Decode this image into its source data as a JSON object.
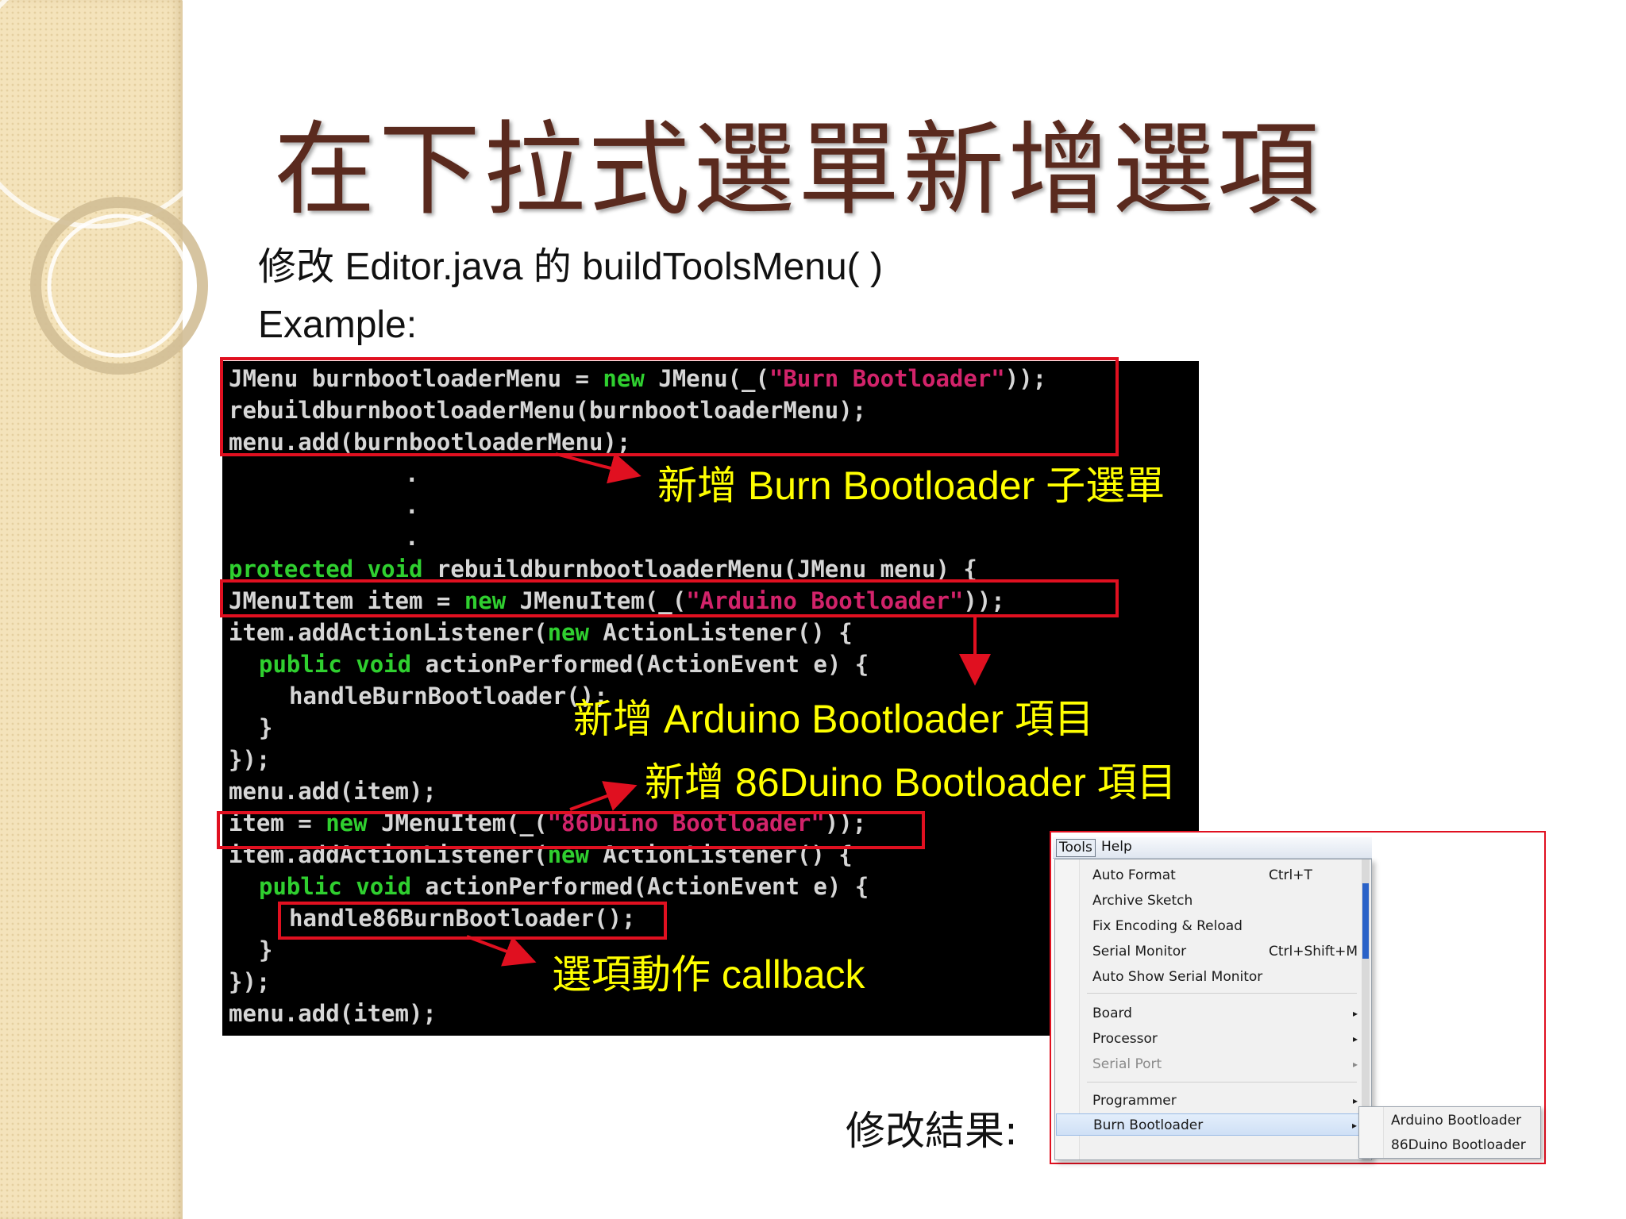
{
  "title": "在下拉式選單新增選項",
  "subtitle": "修改 Editor.java 的 buildToolsMenu( )",
  "example_label": "Example:",
  "code": {
    "line1": {
      "a": "JMenu burnbootloaderMenu = ",
      "kw": "new",
      "b": " JMenu(_(",
      "str": "\"Burn Bootloader\"",
      "c": "));"
    },
    "line2": "rebuildburnbootloaderMenu(burnbootloaderMenu);",
    "line3": "menu.add(burnbootloaderMenu);",
    "dot1": ".",
    "dot2": ".",
    "dot3": ".",
    "line4": {
      "kw1": "protected",
      "sp": " ",
      "kw2": "void",
      "b": " rebuildburnbootloaderMenu(JMenu menu) {"
    },
    "line5": {
      "a": "JMenuItem item = ",
      "kw": "new",
      "b": " JMenuItem(_(",
      "str": "\"Arduino Bootloader\"",
      "c": "));"
    },
    "line6": {
      "a": "item.addActionListener(",
      "kw": "new",
      "b": " ActionListener() {"
    },
    "line7": {
      "kw1": "public",
      "sp": " ",
      "kw2": "void",
      "b": " actionPerformed(ActionEvent e) {"
    },
    "line8": "handleBurnBootloader();",
    "line9": "}",
    "line10": "});",
    "line11": "menu.add(item);",
    "line12": {
      "a": "item = ",
      "kw": "new",
      "b": " JMenuItem(_(",
      "str": "\"86Duino Bootloader\"",
      "c": "));"
    },
    "line13": {
      "a": "item.addActionListener(",
      "kw": "new",
      "b": " ActionListener() {"
    },
    "line14": {
      "kw1": "public",
      "sp": " ",
      "kw2": "void",
      "b": " actionPerformed(ActionEvent e) {"
    },
    "line15": "handle86BurnBootloader();",
    "line16": "}",
    "line17": "});",
    "line18": "menu.add(item);"
  },
  "annotations": {
    "burn_submenu": "新增 Burn Bootloader 子選單",
    "arduino_item": "新增 Arduino Bootloader 項目",
    "duino_item": "新增 86Duino Bootloader 項目",
    "callback": "選項動作 callback"
  },
  "result_label": "修改結果:",
  "menu": {
    "menubar": {
      "tools": "Tools",
      "help": "Help"
    },
    "items": [
      {
        "label": "Auto Format",
        "shortcut": "Ctrl+T"
      },
      {
        "label": "Archive Sketch",
        "shortcut": ""
      },
      {
        "label": "Fix Encoding & Reload",
        "shortcut": ""
      },
      {
        "label": "Serial Monitor",
        "shortcut": "Ctrl+Shift+M"
      },
      {
        "label": "Auto Show Serial Monitor",
        "shortcut": ""
      },
      {
        "label": "Board",
        "arrow": "▸"
      },
      {
        "label": "Processor",
        "arrow": "▸"
      },
      {
        "label": "Serial Port",
        "arrow": "▸"
      },
      {
        "label": "Programmer",
        "arrow": "▸"
      },
      {
        "label": "Burn Bootloader",
        "arrow": "▸"
      }
    ],
    "submenu": [
      "Arduino Bootloader",
      "86Duino Bootloader"
    ]
  },
  "colors": {
    "title": "#5a2a1e",
    "annotation": "#ffff00",
    "highlight_box": "#e01020",
    "code_keyword": "#2fcf2f",
    "code_string": "#d2236a"
  }
}
